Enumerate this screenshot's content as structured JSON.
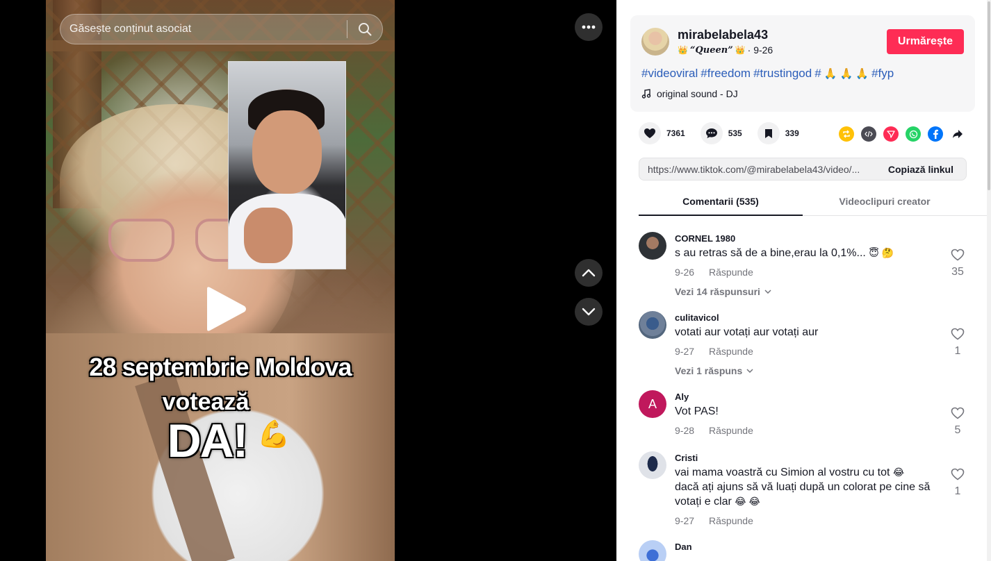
{
  "search": {
    "placeholder": "Găsește conținut asociat"
  },
  "video": {
    "overlay_line1": "28 septembrie Moldova",
    "overlay_line2": "votează",
    "overlay_line3": "DA!",
    "overlay_emoji": "💪"
  },
  "author": {
    "username": "mirabelabela43",
    "nickname_crown": "👑",
    "nickname": "“Queen”",
    "date": "· 9-26",
    "follow_label": "Urmărește"
  },
  "description": {
    "hashtags": [
      "#videoviral",
      "#freedom",
      "#trustingod",
      "#",
      "#fyp"
    ],
    "pray_emoji": "🙏 🙏 🙏",
    "sound": "original sound - DJ"
  },
  "actions": {
    "likes": "7361",
    "comments": "535",
    "saves": "339"
  },
  "share": {
    "icons": [
      "repost-icon",
      "embed-icon",
      "send-icon",
      "whatsapp-icon",
      "facebook-icon",
      "share-arrow-icon"
    ],
    "colors": {
      "repost": "#ffc107",
      "embed": "#4b4b54",
      "send": "#fe2c55",
      "whatsapp": "#25d366",
      "facebook": "#0075fa"
    }
  },
  "link": {
    "url": "https://www.tiktok.com/@mirabelabela43/video/...",
    "copy_label": "Copiază linkul"
  },
  "tabs": [
    {
      "label": "Comentarii (535)",
      "active": true
    },
    {
      "label": "Videoclipuri creator",
      "active": false
    }
  ],
  "comments": [
    {
      "name": "CORNEL 1980",
      "text": "s au retras să de a bine,erau la 0,1%...",
      "emoji": "😇 🤔",
      "date": "9-26",
      "reply": "Răspunde",
      "likes": "35",
      "replies": "Vezi 14 răspunsuri"
    },
    {
      "name": "culitavicol",
      "text": "votati aur votați aur votați aur",
      "emoji": "",
      "date": "9-27",
      "reply": "Răspunde",
      "likes": "1",
      "replies": "Vezi 1 răspuns"
    },
    {
      "name": "Aly",
      "text": "Vot PAS!",
      "emoji": "",
      "date": "9-28",
      "reply": "Răspunde",
      "likes": "5",
      "avatar_letter": "A"
    },
    {
      "name": "Cristi",
      "text_line1": "vai mama voastră cu Simion al vostru cu tot",
      "text_line2": "dacă ați ajuns să vă luați după un colorat pe cine să",
      "text_line3": "votați e clar",
      "emoji1": "😂",
      "emoji2": "😂 😂",
      "date": "9-27",
      "reply": "Răspunde",
      "likes": "1"
    },
    {
      "name": "Dan"
    }
  ],
  "colors": {
    "brand": "#fe2c55",
    "hashtag": "#2b5db9",
    "aly_avatar": "#c0185c"
  }
}
